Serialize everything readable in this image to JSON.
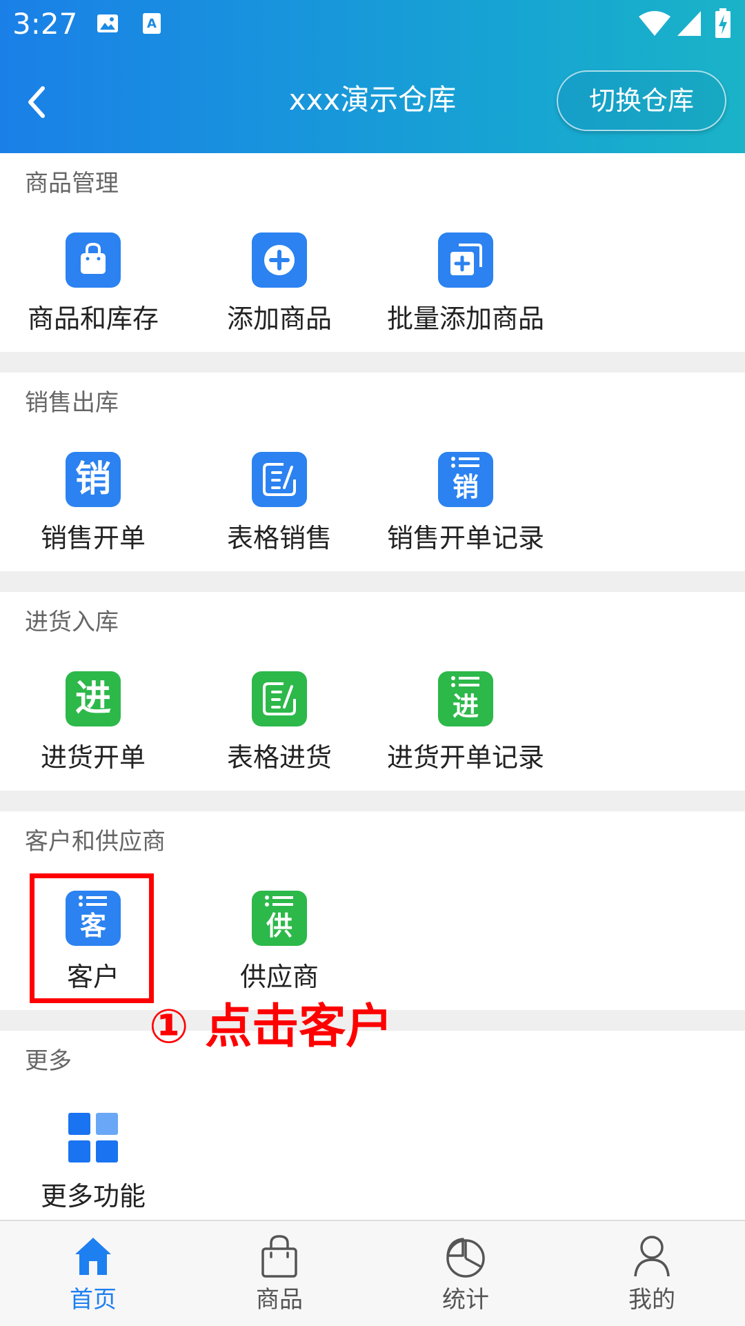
{
  "status_bar": {
    "time": "3:27"
  },
  "header": {
    "title": "xxx演示仓库",
    "switch_label": "切换仓库"
  },
  "sections": [
    {
      "title": "商品管理",
      "items": [
        {
          "label": "商品和库存",
          "icon": "shopping-bag-icon",
          "color": "#2b82f0"
        },
        {
          "label": "添加商品",
          "icon": "add-circle-icon",
          "color": "#2b82f0"
        },
        {
          "label": "批量添加商品",
          "icon": "batch-add-icon",
          "color": "#2b82f0"
        }
      ]
    },
    {
      "title": "销售出库",
      "items": [
        {
          "label": "销售开单",
          "icon": "sales-order-icon",
          "icon_text": "销",
          "color": "#2b82f0"
        },
        {
          "label": "表格销售",
          "icon": "table-edit-icon",
          "color": "#2b82f0"
        },
        {
          "label": "销售开单记录",
          "icon": "sales-record-icon",
          "icon_text": "销",
          "color": "#2b82f0"
        }
      ]
    },
    {
      "title": "进货入库",
      "items": [
        {
          "label": "进货开单",
          "icon": "purchase-order-icon",
          "icon_text": "进",
          "color": "#2db84a"
        },
        {
          "label": "表格进货",
          "icon": "table-edit-icon",
          "color": "#2db84a"
        },
        {
          "label": "进货开单记录",
          "icon": "purchase-record-icon",
          "icon_text": "进",
          "color": "#2db84a"
        }
      ]
    },
    {
      "title": "客户和供应商",
      "items": [
        {
          "label": "客户",
          "icon": "customer-list-icon",
          "icon_text": "客",
          "color": "#2b82f0"
        },
        {
          "label": "供应商",
          "icon": "supplier-list-icon",
          "icon_text": "供",
          "color": "#2db84a"
        }
      ]
    },
    {
      "title": "更多",
      "items": [
        {
          "label": "更多功能",
          "icon": "grid-icon",
          "color": "#2b82f0"
        }
      ]
    }
  ],
  "annotation": {
    "text": "① 点击客户",
    "color": "#ff0000"
  },
  "tabs": [
    {
      "label": "首页",
      "icon": "home-icon",
      "active": true
    },
    {
      "label": "商品",
      "icon": "bag-icon",
      "active": false
    },
    {
      "label": "统计",
      "icon": "pie-chart-icon",
      "active": false
    },
    {
      "label": "我的",
      "icon": "user-icon",
      "active": false
    }
  ],
  "colors": {
    "accent": "#2b82f0",
    "green": "#2db84a",
    "header_start": "#1a80e8",
    "header_end": "#1ab3c8",
    "active_tab": "#1e7ff0"
  }
}
